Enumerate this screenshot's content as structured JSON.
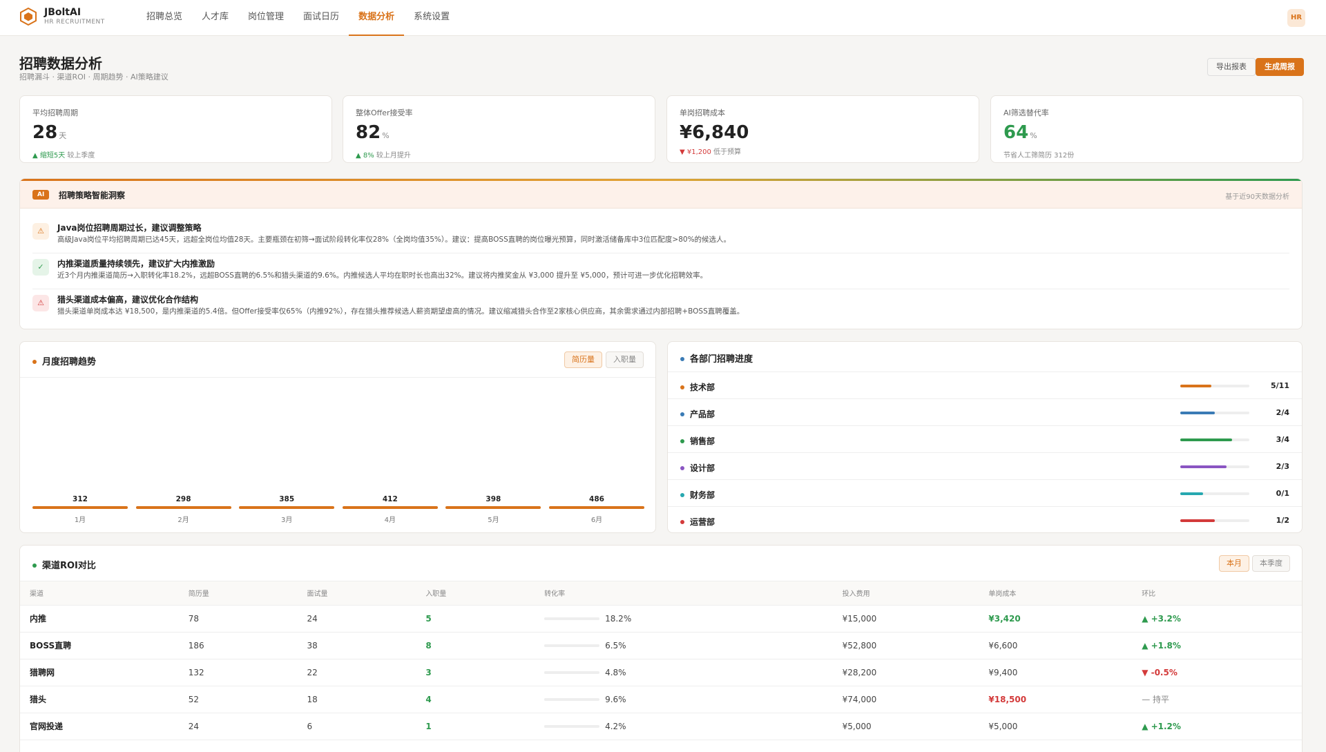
{
  "brand": {
    "name": "JBoltAI",
    "sub": "HR RECRUITMENT"
  },
  "nav": [
    {
      "label": "招聘总览",
      "active": false
    },
    {
      "label": "人才库",
      "active": false
    },
    {
      "label": "岗位管理",
      "active": false
    },
    {
      "label": "面试日历",
      "active": false
    },
    {
      "label": "数据分析",
      "active": true
    },
    {
      "label": "系统设置",
      "active": false
    }
  ],
  "avatar": "HR",
  "header": {
    "title": "招聘数据分析",
    "subtitle": "招聘漏斗 · 渠道ROI · 周期趋势 · AI策略建议",
    "export_label": "导出报表",
    "generate_label": "生成周报"
  },
  "kpis": [
    {
      "label": "平均招聘周期",
      "value": "28",
      "unit": "天",
      "trend_main": "▲ 缩短5天",
      "trend_rest": " 较上季度",
      "trend_dir": "up",
      "green": false
    },
    {
      "label": "整体Offer接受率",
      "value": "82",
      "unit": "%",
      "trend_main": "▲ 8%",
      "trend_rest": " 较上月提升",
      "trend_dir": "up",
      "green": false
    },
    {
      "label": "单岗招聘成本",
      "value": "¥6,840",
      "unit": "",
      "trend_main": "▼ ¥1,200",
      "trend_rest": " 低于预算",
      "trend_dir": "down",
      "green": false
    },
    {
      "label": "AI筛选替代率",
      "value": "64",
      "unit": "%",
      "trend_main": "",
      "trend_rest": "节省人工筛简历 312份",
      "trend_dir": "none",
      "green": true
    }
  ],
  "ai_panel": {
    "badge": "AI",
    "title": "招聘策略智能洞察",
    "note": "基于近90天数据分析",
    "items": [
      {
        "icon": "warning-icon",
        "kind": "warn",
        "glyph": "⚠",
        "title": "Java岗位招聘周期过长，建议调整策略",
        "desc": "高级Java岗位平均招聘周期已达45天，远超全岗位均值28天。主要瓶颈在初筛→面试阶段转化率仅28%（全岗均值35%）。建议：提高BOSS直聘的岗位曝光预算，同时激活储备库中3位匹配度>80%的候选人。"
      },
      {
        "icon": "check-icon",
        "kind": "ok",
        "glyph": "✓",
        "title": "内推渠道质量持续领先，建议扩大内推激励",
        "desc": "近3个月内推渠道简历→入职转化率18.2%，远超BOSS直聘的6.5%和猎头渠道的9.6%。内推候选人平均在职时长也高出32%。建议将内推奖金从 ¥3,000 提升至 ¥5,000，预计可进一步优化招聘效率。"
      },
      {
        "icon": "alert-icon",
        "kind": "alert",
        "glyph": "⚠",
        "title": "猎头渠道成本偏高，建议优化合作结构",
        "desc": "猎头渠道单岗成本达 ¥18,500，是内推渠道的5.4倍。但Offer接受率仅65%（内推92%），存在猎头推荐候选人薪资期望虚高的情况。建议缩减猎头合作至2家核心供应商，其余需求通过内部招聘+BOSS直聘覆盖。"
      }
    ]
  },
  "trend": {
    "title": "月度招聘趋势",
    "seg_resume": "简历量",
    "seg_hire": "入职量",
    "accent": "#d9731a",
    "chart_data": {
      "type": "bar",
      "categories": [
        "1月",
        "2月",
        "3月",
        "4月",
        "5月",
        "6月"
      ],
      "values": [
        312,
        298,
        385,
        412,
        398,
        486
      ],
      "title": "",
      "xlabel": "",
      "ylabel": ""
    }
  },
  "departments": {
    "title": "各部门招聘进度",
    "items": [
      {
        "name": "技术部",
        "count": "5/11",
        "progress": 0.45,
        "color": "#d9731a"
      },
      {
        "name": "产品部",
        "count": "2/4",
        "progress": 0.5,
        "color": "#3a7bb5"
      },
      {
        "name": "销售部",
        "count": "3/4",
        "progress": 0.75,
        "color": "#2e9a4e"
      },
      {
        "name": "设计部",
        "count": "2/3",
        "progress": 0.67,
        "color": "#8a55c2"
      },
      {
        "name": "财务部",
        "count": "0/1",
        "progress": 0.33,
        "color": "#27a8b0"
      },
      {
        "name": "运营部",
        "count": "1/2",
        "progress": 0.5,
        "color": "#d33a3a"
      }
    ]
  },
  "roi": {
    "title": "渠道ROI对比",
    "seg_month": "本月",
    "seg_quarter": "本季度",
    "columns": [
      "渠道",
      "简历量",
      "面试量",
      "入职量",
      "转化率",
      "投入费用",
      "单岗成本",
      "环比"
    ],
    "rows": [
      {
        "channel": "内推",
        "resumes": "78",
        "interviews": "24",
        "hires": "5",
        "rate": "18.2%",
        "rate_value": 0.182,
        "cost": "¥15,000",
        "unit_cost": "¥3,420",
        "unit_cls": "good",
        "mom": "▲ +3.2%",
        "mom_cls": "mom-up"
      },
      {
        "channel": "BOSS直聘",
        "resumes": "186",
        "interviews": "38",
        "hires": "8",
        "rate": "6.5%",
        "rate_value": 0.065,
        "cost": "¥52,800",
        "unit_cost": "¥6,600",
        "unit_cls": "",
        "mom": "▲ +1.8%",
        "mom_cls": "mom-up"
      },
      {
        "channel": "猎聘网",
        "resumes": "132",
        "interviews": "22",
        "hires": "3",
        "rate": "4.8%",
        "rate_value": 0.048,
        "cost": "¥28,200",
        "unit_cost": "¥9,400",
        "unit_cls": "",
        "mom": "▼ -0.5%",
        "mom_cls": "mom-down"
      },
      {
        "channel": "猎头",
        "resumes": "52",
        "interviews": "18",
        "hires": "4",
        "rate": "9.6%",
        "rate_value": 0.096,
        "cost": "¥74,000",
        "unit_cost": "¥18,500",
        "unit_cls": "bad",
        "mom": "— 持平",
        "mom_cls": "mom-flat"
      },
      {
        "channel": "官网投递",
        "resumes": "24",
        "interviews": "6",
        "hires": "1",
        "rate": "4.2%",
        "rate_value": 0.042,
        "cost": "¥5,000",
        "unit_cost": "¥5,000",
        "unit_cls": "",
        "mom": "▲ +1.2%",
        "mom_cls": "mom-up"
      }
    ]
  }
}
